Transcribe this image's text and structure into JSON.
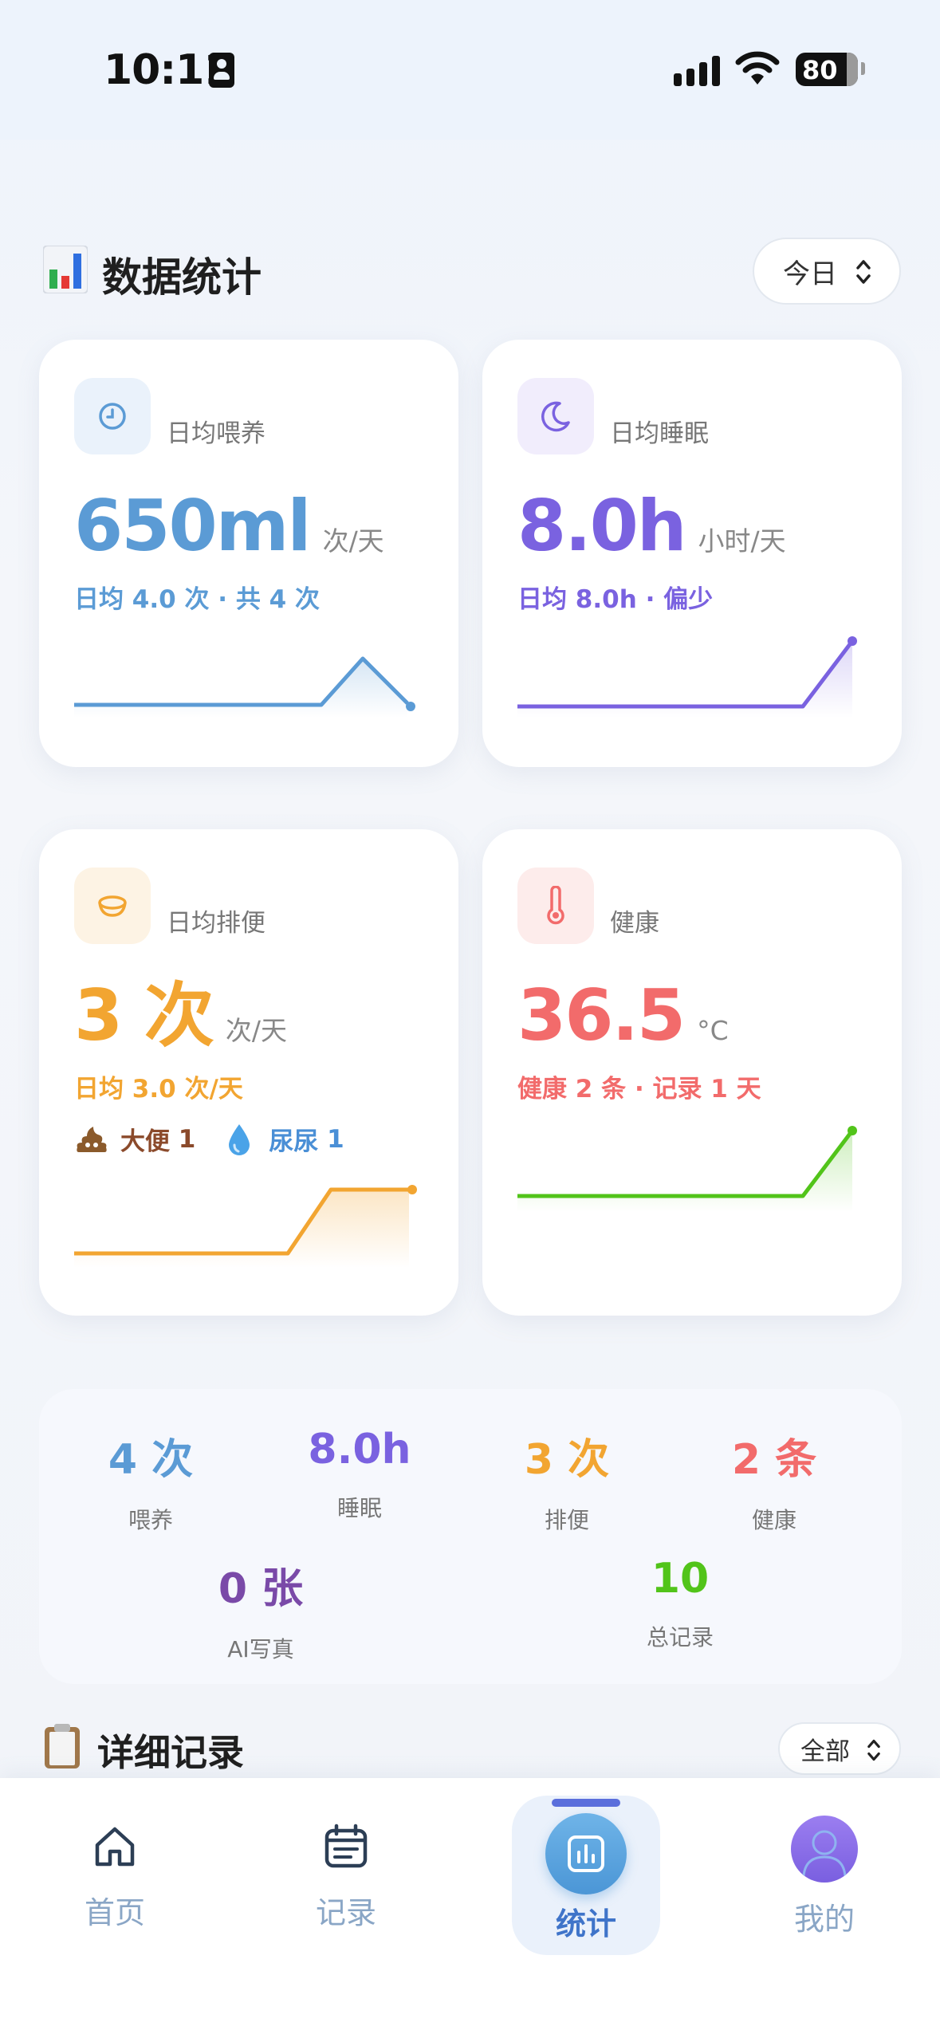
{
  "status_bar": {
    "time": "10:11",
    "battery": "80"
  },
  "header": {
    "title": "数据统计",
    "period": "今日"
  },
  "cards": {
    "feeding": {
      "label": "日均喂养",
      "value": "650ml",
      "unit": "次/天",
      "sub": "日均 4.0 次 · 共 4 次",
      "color": "#5b9bd5"
    },
    "sleep": {
      "label": "日均睡眠",
      "value": "8.0h",
      "unit": "小时/天",
      "sub": "日均 8.0h · 偏少",
      "color": "#7a62e0"
    },
    "poop": {
      "label": "日均排便",
      "value": "3 次",
      "unit": "次/天",
      "sub": "日均 3.0 次/天",
      "color": "#f2a531",
      "poo_label": "大便",
      "poo_count": "1",
      "pee_label": "尿尿",
      "pee_count": "1"
    },
    "health": {
      "label": "健康",
      "value": "36.5",
      "unit": "°C",
      "sub": "健康 2 条 · 记录 1 天",
      "color": "#f26b6b"
    }
  },
  "summary": [
    {
      "value": "4 次",
      "label": "喂养",
      "color": "#5b9bd5"
    },
    {
      "value": "8.0h",
      "label": "睡眠",
      "color": "#7a62e0"
    },
    {
      "value": "3 次",
      "label": "排便",
      "color": "#f2a531"
    },
    {
      "value": "2 条",
      "label": "健康",
      "color": "#f26b6b"
    },
    {
      "value": "0 张",
      "label": "AI写真",
      "color": "#7a4aa8"
    },
    {
      "value": "10",
      "label": "总记录",
      "color": "#52c41a"
    }
  ],
  "details": {
    "title": "详细记录",
    "filter": "全部"
  },
  "tabs": {
    "home": "首页",
    "records": "记录",
    "stats": "统计",
    "mine": "我的"
  }
}
